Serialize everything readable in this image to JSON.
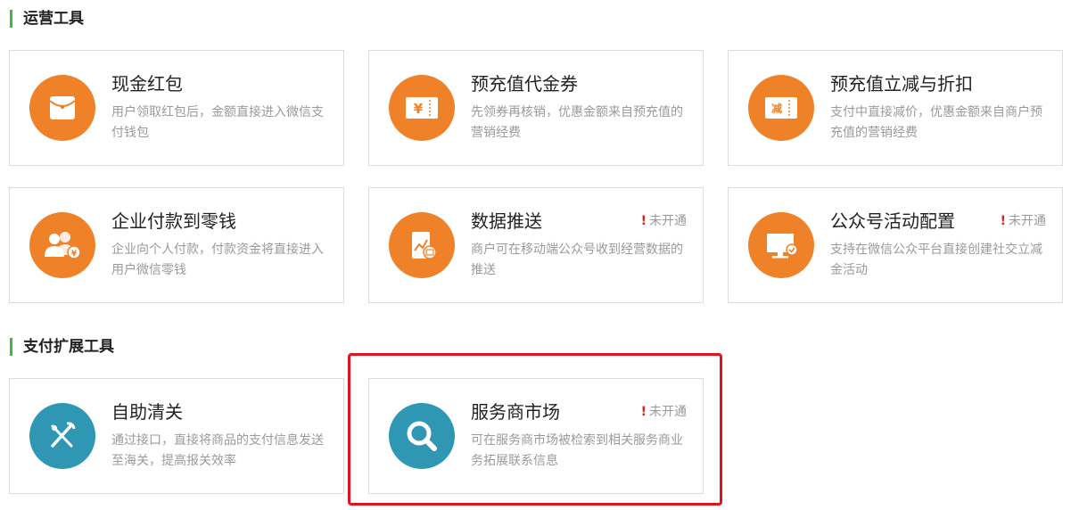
{
  "sections": {
    "ops_title": "运营工具",
    "pay_title": "支付扩展工具"
  },
  "cards": [
    {
      "title": "现金红包",
      "desc": "用户领取红包后，金额直接进入微信支付钱包",
      "status": "",
      "icon": "red-envelope-icon"
    },
    {
      "title": "预充值代金券",
      "desc": "先领券再核销，优惠金额来自预充值的营销经费",
      "status": "",
      "icon": "yuan-coupon-icon"
    },
    {
      "title": "预充值立减与折扣",
      "desc": "支付中直接减价，优惠金额来自商户预充值的营销经费",
      "status": "",
      "icon": "discount-ticket-icon"
    },
    {
      "title": "企业付款到零钱",
      "desc": "企业向个人付款，付款资金将直接进入用户微信零钱",
      "status": "",
      "icon": "users-payment-icon"
    },
    {
      "title": "数据推送",
      "desc": "商户可在移动端公众号收到经营数据的推送",
      "status": "未开通",
      "icon": "tablet-chart-icon"
    },
    {
      "title": "公众号活动配置",
      "desc": "支持在微信公众平台直接创建社交立减金活动",
      "status": "未开通",
      "icon": "monitor-config-icon"
    },
    {
      "title": "自助清关",
      "desc": "通过接口，直接将商品的支付信息发送至海关，提高报关效率",
      "status": "",
      "icon": "tools-customs-icon"
    },
    {
      "title": "服务商市场",
      "desc": "可在服务商市场被检索到相关服务商业务拓展联系信息",
      "status": "未开通",
      "icon": "search-magnifier-icon"
    }
  ],
  "status_mark": "!",
  "colors": {
    "accent_green": "#44b549",
    "icon_orange": "#ef8129",
    "icon_teal": "#2f97b3",
    "alert_red": "#e02020",
    "highlight_red": "#e0141e"
  }
}
